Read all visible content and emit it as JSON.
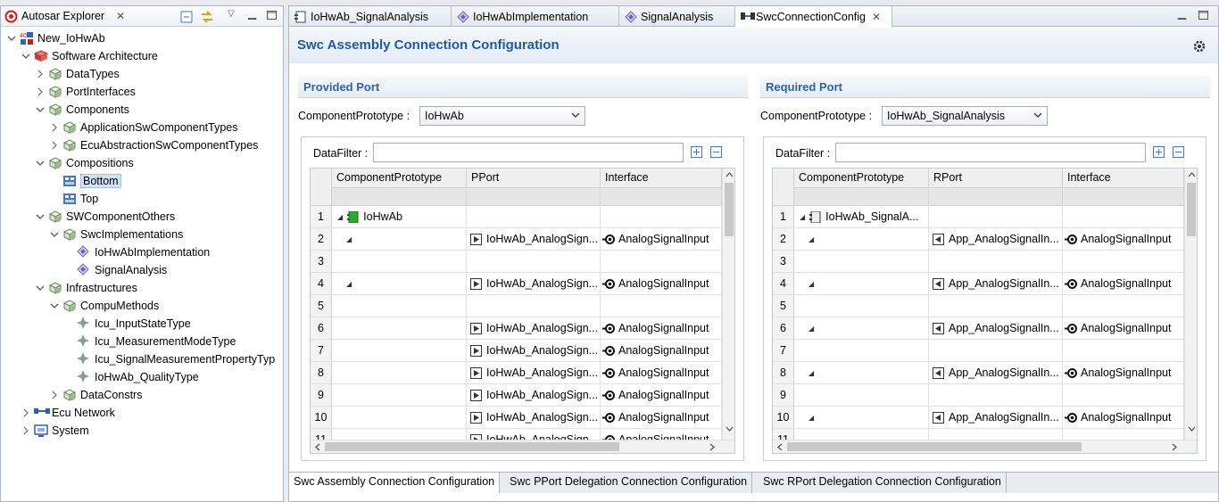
{
  "explorer": {
    "title": "Autosar Explorer",
    "tree": [
      {
        "label": "New_IoHwAb",
        "icon": "autosar-project-icon",
        "level": 0,
        "state": "open"
      },
      {
        "label": "Software Architecture",
        "icon": "software-architecture-icon",
        "level": 1,
        "state": "open"
      },
      {
        "label": "DataTypes",
        "icon": "package-icon",
        "level": 2,
        "state": "closed"
      },
      {
        "label": "PortInterfaces",
        "icon": "package-icon",
        "level": 2,
        "state": "closed"
      },
      {
        "label": "Components",
        "icon": "package-icon",
        "level": 2,
        "state": "open"
      },
      {
        "label": "ApplicationSwComponentTypes",
        "icon": "package-icon",
        "level": 3,
        "state": "closed"
      },
      {
        "label": "EcuAbstractionSwComponentTypes",
        "icon": "package-icon",
        "level": 3,
        "state": "closed"
      },
      {
        "label": "Compositions",
        "icon": "package-icon",
        "level": 2,
        "state": "open"
      },
      {
        "label": "Bottom",
        "icon": "composition-icon",
        "level": 3,
        "state": "leaf",
        "selected": true
      },
      {
        "label": "Top",
        "icon": "composition-icon",
        "level": 3,
        "state": "leaf"
      },
      {
        "label": "SWComponentOthers",
        "icon": "package-icon",
        "level": 2,
        "state": "open"
      },
      {
        "label": "SwcImplementations",
        "icon": "package-icon",
        "level": 3,
        "state": "open"
      },
      {
        "label": "IoHwAbImplementation",
        "icon": "implementation-icon",
        "level": 4,
        "state": "leaf"
      },
      {
        "label": "SignalAnalysis",
        "icon": "implementation-icon",
        "level": 4,
        "state": "leaf"
      },
      {
        "label": "Infrastructures",
        "icon": "package-icon",
        "level": 2,
        "state": "open"
      },
      {
        "label": "CompuMethods",
        "icon": "package-icon",
        "level": 3,
        "state": "open"
      },
      {
        "label": "Icu_InputStateType",
        "icon": "compu-method-icon",
        "level": 4,
        "state": "leaf"
      },
      {
        "label": "Icu_MeasurementModeType",
        "icon": "compu-method-icon",
        "level": 4,
        "state": "leaf"
      },
      {
        "label": "Icu_SignalMeasurementPropertyTyp",
        "icon": "compu-method-icon",
        "level": 4,
        "state": "leaf"
      },
      {
        "label": "IoHwAb_QualityType",
        "icon": "compu-method-icon",
        "level": 4,
        "state": "leaf"
      },
      {
        "label": "DataConstrs",
        "icon": "package-icon",
        "level": 3,
        "state": "closed"
      },
      {
        "label": "Ecu Network",
        "icon": "ecu-network-icon",
        "level": 1,
        "state": "closed"
      },
      {
        "label": "System",
        "icon": "system-icon",
        "level": 1,
        "state": "closed"
      }
    ]
  },
  "editor_tabs": [
    {
      "label": "IoHwAb_SignalAnalysis",
      "icon": "component-icon"
    },
    {
      "label": "IoHwAbImplementation",
      "icon": "implementation-icon"
    },
    {
      "label": "SignalAnalysis",
      "icon": "implementation-icon"
    },
    {
      "label": "SwcConnectionConfig",
      "icon": "connection-icon",
      "active": true
    }
  ],
  "form": {
    "title": "Swc Assembly Connection Configuration",
    "provided": {
      "section": "Provided Port",
      "combo_label": "ComponentPrototype :",
      "combo_value": "IoHwAb",
      "filter_label": "DataFilter :",
      "filter_value": "",
      "columns": [
        "ComponentPrototype",
        "PPort",
        "Interface"
      ],
      "rows": [
        {
          "n": "1",
          "proto": "IoHwAb",
          "proto_icon": "green",
          "expand": "open",
          "port": "",
          "iface": ""
        },
        {
          "n": "2",
          "proto": "",
          "expand": "open",
          "port": "IoHwAb_AnalogSign...",
          "iface": "AnalogSignalInput"
        },
        {
          "n": "3",
          "proto": "",
          "port": "",
          "iface": ""
        },
        {
          "n": "4",
          "proto": "",
          "expand": "open",
          "port": "IoHwAb_AnalogSign...",
          "iface": "AnalogSignalInput"
        },
        {
          "n": "5",
          "proto": "",
          "port": "",
          "iface": ""
        },
        {
          "n": "6",
          "proto": "",
          "port": "IoHwAb_AnalogSign...",
          "iface": "AnalogSignalInput"
        },
        {
          "n": "7",
          "proto": "",
          "port": "IoHwAb_AnalogSign...",
          "iface": "AnalogSignalInput"
        },
        {
          "n": "8",
          "proto": "",
          "port": "IoHwAb_AnalogSign...",
          "iface": "AnalogSignalInput"
        },
        {
          "n": "9",
          "proto": "",
          "port": "IoHwAb_AnalogSign...",
          "iface": "AnalogSignalInput"
        },
        {
          "n": "10",
          "proto": "",
          "port": "IoHwAb_AnalogSign...",
          "iface": "AnalogSignalInput"
        },
        {
          "n": "11",
          "proto": "",
          "port": "IoHwAb_AnalogSign...",
          "iface": "AnalogSignalInput"
        }
      ]
    },
    "required": {
      "section": "Required Port",
      "combo_label": "ComponentPrototype :",
      "combo_value": "IoHwAb_SignalAnalysis",
      "filter_label": "DataFilter :",
      "filter_value": "",
      "columns": [
        "ComponentPrototype",
        "RPort",
        "Interface"
      ],
      "rows": [
        {
          "n": "1",
          "proto": "IoHwAb_SignalA...",
          "proto_icon": "gray",
          "expand": "open",
          "port": "",
          "iface": ""
        },
        {
          "n": "2",
          "proto": "",
          "expand": "open",
          "port": "App_AnalogSignalIn...",
          "iface": "AnalogSignalInput"
        },
        {
          "n": "3",
          "proto": "",
          "port": "",
          "iface": ""
        },
        {
          "n": "4",
          "proto": "",
          "expand": "open",
          "port": "App_AnalogSignalIn...",
          "iface": "AnalogSignalInput"
        },
        {
          "n": "5",
          "proto": "",
          "port": "",
          "iface": ""
        },
        {
          "n": "6",
          "proto": "",
          "expand": "open",
          "port": "App_AnalogSignalIn...",
          "iface": "AnalogSignalInput"
        },
        {
          "n": "7",
          "proto": "",
          "port": "",
          "iface": ""
        },
        {
          "n": "8",
          "proto": "",
          "expand": "open",
          "port": "App_AnalogSignalIn...",
          "iface": "AnalogSignalInput"
        },
        {
          "n": "9",
          "proto": "",
          "port": "",
          "iface": ""
        },
        {
          "n": "10",
          "proto": "",
          "expand": "open",
          "port": "App_AnalogSignalIn...",
          "iface": "AnalogSignalInput"
        },
        {
          "n": "11",
          "proto": "",
          "port": "",
          "iface": ""
        }
      ]
    }
  },
  "bottom_tabs": [
    {
      "label": "Swc Assembly Connection Configuration",
      "active": true
    },
    {
      "label": "Swc PPort Delegation Connection Configuration"
    },
    {
      "label": "Swc RPort Delegation Connection Configuration"
    }
  ],
  "colors": {
    "accent": "#1f5aa0",
    "selection": "#cde3f7",
    "border": "#a9b7cb"
  }
}
